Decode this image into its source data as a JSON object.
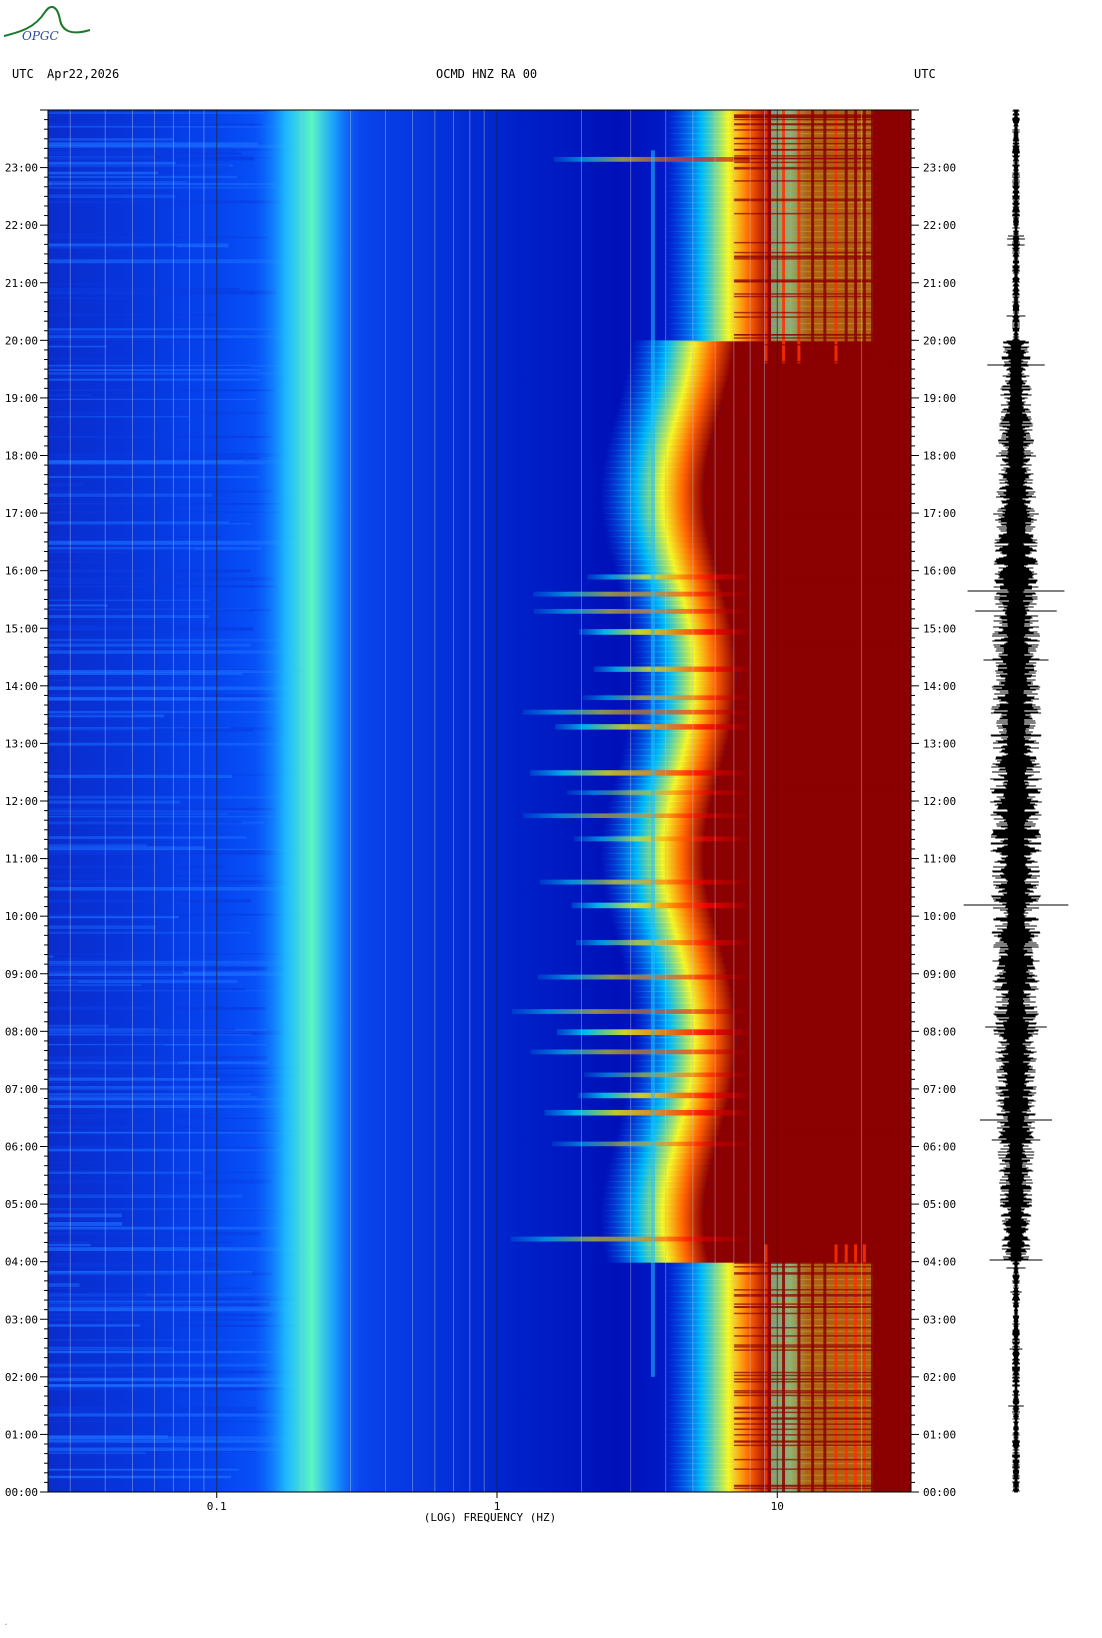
{
  "header": {
    "left_tz": "UTC",
    "date": "Apr22,2026",
    "station": "OCMD HNZ RA 00",
    "right_tz": "UTC"
  },
  "logo": {
    "text": "OPGC",
    "color": "#1a7a2a"
  },
  "footer_mark": "´",
  "chart_data": {
    "type": "heatmap",
    "title": "OCMD HNZ RA 00",
    "xlabel": "(LOG) FREQUENCY (HZ)",
    "x_scale": "log",
    "xlim": [
      0.025,
      30
    ],
    "x_ticks": [
      {
        "value": 0.1,
        "label": "0.1"
      },
      {
        "value": 1,
        "label": "1"
      },
      {
        "value": 10,
        "label": "10"
      }
    ],
    "y_ticks": [
      "00:00",
      "01:00",
      "02:00",
      "03:00",
      "04:00",
      "05:00",
      "06:00",
      "07:00",
      "08:00",
      "09:00",
      "10:00",
      "11:00",
      "12:00",
      "13:00",
      "14:00",
      "15:00",
      "16:00",
      "17:00",
      "18:00",
      "19:00",
      "20:00",
      "21:00",
      "22:00",
      "23:00"
    ],
    "ylim_hours": [
      0,
      24
    ],
    "colormap": [
      "#00008b",
      "#0000ff",
      "#00aaff",
      "#00ffff",
      "#ffff00",
      "#ff8000",
      "#ff0000",
      "#8b0000"
    ],
    "features": {
      "microseism_band_hz": [
        0.18,
        0.26
      ],
      "high_freq_saturation_hz": 8,
      "events_hours": [
        4.4,
        6.05,
        6.6,
        6.9,
        7.25,
        7.65,
        8.0,
        8.35,
        8.95,
        9.55,
        10.2,
        10.6,
        11.35,
        11.75,
        12.15,
        12.5,
        13.3,
        13.55,
        13.8,
        14.3,
        14.95,
        15.3,
        15.6,
        15.9,
        23.15
      ],
      "narrow_line_hz": 3.6
    },
    "waveform": {
      "type": "trace",
      "envelope_hours": [
        0,
        24
      ],
      "active_hours": [
        4,
        20
      ]
    }
  }
}
